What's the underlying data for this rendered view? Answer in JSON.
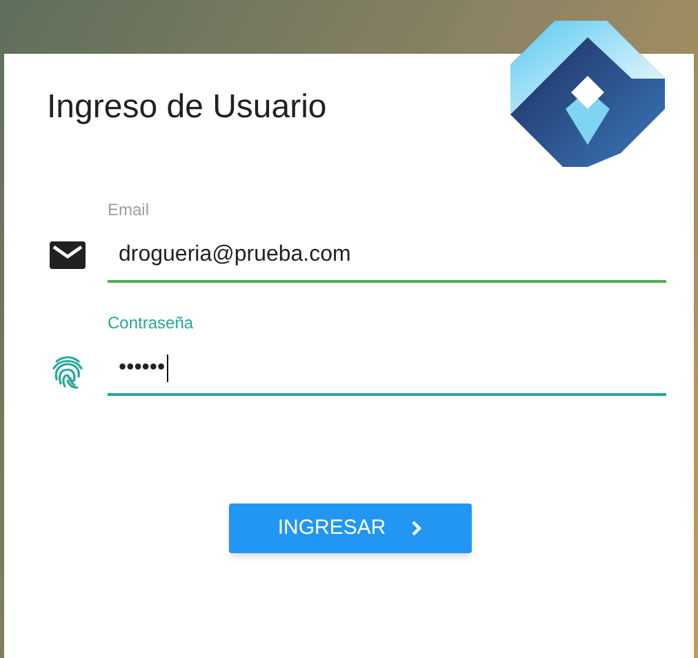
{
  "card": {
    "title": "Ingreso de Usuario"
  },
  "fields": [
    {
      "kind": "email",
      "label": "Email",
      "value": "drogueria@prueba.com",
      "focused": false
    },
    {
      "kind": "password",
      "label": "Contraseña",
      "value": "••••••",
      "focused": true
    }
  ],
  "button": {
    "label": "INGRESAR"
  }
}
